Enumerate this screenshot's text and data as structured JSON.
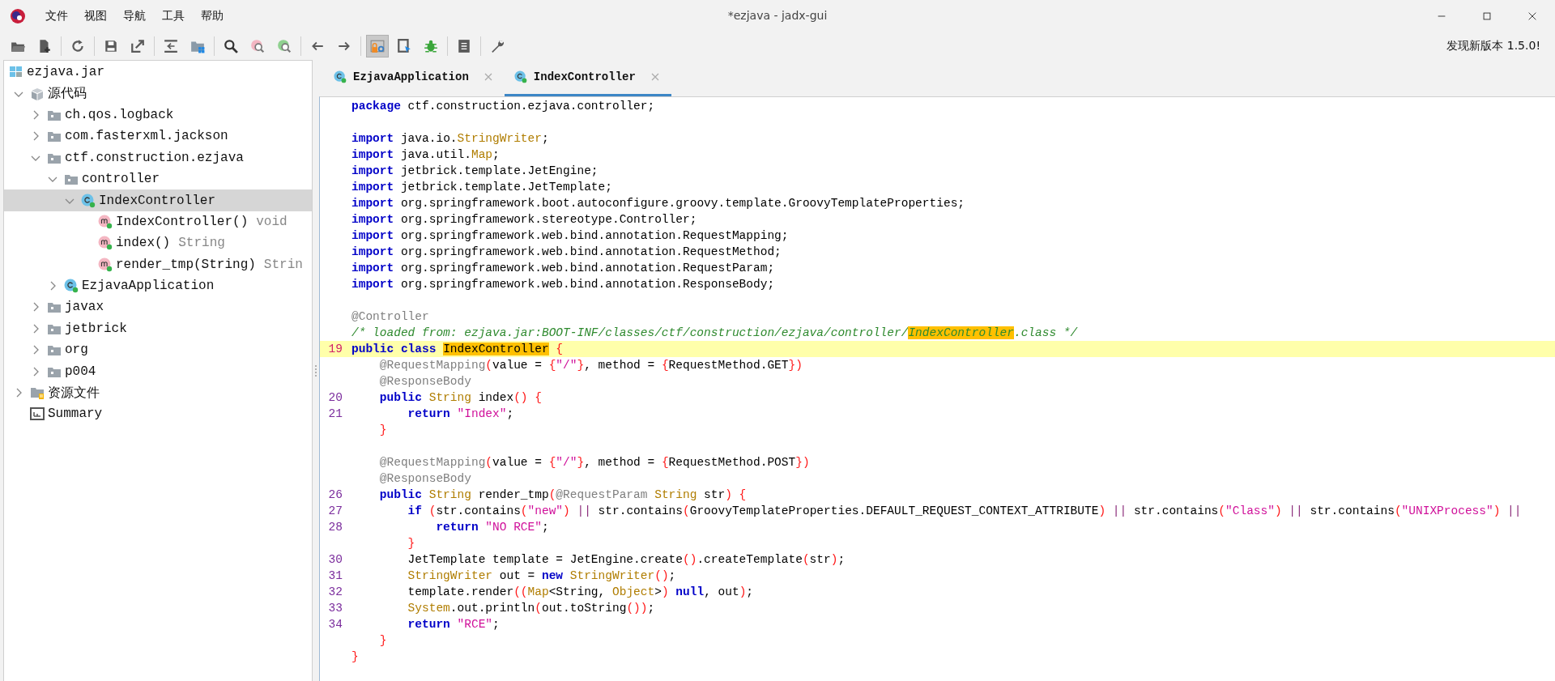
{
  "window": {
    "title": "*ezjava - jadx-gui"
  },
  "menu": [
    "文件",
    "视图",
    "导航",
    "工具",
    "帮助"
  ],
  "toolbar": [
    {
      "kind": "open",
      "pressed": false
    },
    {
      "kind": "add-file",
      "pressed": false
    },
    {
      "kind": "separator"
    },
    {
      "kind": "refresh",
      "pressed": false
    },
    {
      "kind": "separator"
    },
    {
      "kind": "save",
      "pressed": false
    },
    {
      "kind": "export",
      "pressed": false
    },
    {
      "kind": "separator"
    },
    {
      "kind": "sync",
      "pressed": false
    },
    {
      "kind": "grid-folder",
      "pressed": false
    },
    {
      "kind": "separator"
    },
    {
      "kind": "search",
      "pressed": false
    },
    {
      "kind": "search-pink",
      "pressed": false
    },
    {
      "kind": "search-green",
      "pressed": false
    },
    {
      "kind": "separator"
    },
    {
      "kind": "back",
      "pressed": false
    },
    {
      "kind": "forward",
      "pressed": false
    },
    {
      "kind": "separator"
    },
    {
      "kind": "lock-gear",
      "pressed": true
    },
    {
      "kind": "doc-cursor",
      "pressed": false
    },
    {
      "kind": "bug",
      "pressed": false
    },
    {
      "kind": "separator"
    },
    {
      "kind": "list",
      "pressed": false
    },
    {
      "kind": "separator"
    },
    {
      "kind": "wrench",
      "pressed": false
    }
  ],
  "update_notice": "发现新版本 1.5.0!",
  "tree": [
    {
      "kind": "jar",
      "label": "ezjava.jar",
      "selected": false,
      "children": [
        {
          "kind": "sources",
          "label": "源代码",
          "expanded": true,
          "selected": false,
          "children": [
            {
              "kind": "package",
              "label": "ch.qos.logback",
              "expanded": false,
              "selected": false
            },
            {
              "kind": "package",
              "label": "com.fasterxml.jackson",
              "expanded": false,
              "selected": false
            },
            {
              "kind": "package",
              "label": "ctf.construction.ezjava",
              "expanded": true,
              "selected": false,
              "children": [
                {
                  "kind": "package",
                  "label": "controller",
                  "expanded": true,
                  "selected": false,
                  "children": [
                    {
                      "kind": "class",
                      "label": "IndexController",
                      "expanded": true,
                      "selected": true,
                      "children": [
                        {
                          "kind": "method",
                          "label": "IndexController()",
                          "type": "void",
                          "selected": false
                        },
                        {
                          "kind": "method",
                          "label": "index()",
                          "type": "String",
                          "selected": false
                        },
                        {
                          "kind": "method",
                          "label": "render_tmp(String)",
                          "type": "Strin",
                          "selected": false
                        }
                      ]
                    }
                  ]
                },
                {
                  "kind": "class",
                  "label": "EzjavaApplication",
                  "expanded": false,
                  "selected": false
                }
              ]
            },
            {
              "kind": "package",
              "label": "javax",
              "expanded": false,
              "selected": false
            },
            {
              "kind": "package",
              "label": "jetbrick",
              "expanded": false,
              "selected": false
            },
            {
              "kind": "package",
              "label": "org",
              "expanded": false,
              "selected": false
            },
            {
              "kind": "package",
              "label": "p004",
              "expanded": false,
              "selected": false
            }
          ]
        },
        {
          "kind": "resources",
          "label": "资源文件",
          "expanded": false,
          "selected": false
        },
        {
          "kind": "summary",
          "label": "Summary",
          "selected": false
        }
      ]
    }
  ],
  "tabs": [
    {
      "label": "EzjavaApplication",
      "selected": false
    },
    {
      "label": "IndexController",
      "selected": true
    }
  ],
  "code": [
    {
      "kind": "code",
      "current": false,
      "segments": [
        {
          "kind": "keyword",
          "text": "package"
        },
        {
          "kind": "plain",
          "text": " ctf.construction.ezjava.controller;"
        }
      ]
    },
    {
      "kind": "blank"
    },
    {
      "kind": "code",
      "current": false,
      "segments": [
        {
          "kind": "keyword",
          "text": "import"
        },
        {
          "kind": "plain",
          "text": " java.io."
        },
        {
          "kind": "type",
          "text": "StringWriter"
        },
        {
          "kind": "plain",
          "text": ";"
        }
      ]
    },
    {
      "kind": "code",
      "current": false,
      "segments": [
        {
          "kind": "keyword",
          "text": "import"
        },
        {
          "kind": "plain",
          "text": " java.util."
        },
        {
          "kind": "type",
          "text": "Map"
        },
        {
          "kind": "plain",
          "text": ";"
        }
      ]
    },
    {
      "kind": "code",
      "current": false,
      "segments": [
        {
          "kind": "keyword",
          "text": "import"
        },
        {
          "kind": "plain",
          "text": " jetbrick.template.JetEngine;"
        }
      ]
    },
    {
      "kind": "code",
      "current": false,
      "segments": [
        {
          "kind": "keyword",
          "text": "import"
        },
        {
          "kind": "plain",
          "text": " jetbrick.template.JetTemplate;"
        }
      ]
    },
    {
      "kind": "code",
      "current": false,
      "segments": [
        {
          "kind": "keyword",
          "text": "import"
        },
        {
          "kind": "plain",
          "text": " org.springframework.boot.autoconfigure.groovy.template.GroovyTemplateProperties;"
        }
      ]
    },
    {
      "kind": "code",
      "current": false,
      "segments": [
        {
          "kind": "keyword",
          "text": "import"
        },
        {
          "kind": "plain",
          "text": " org.springframework.stereotype.Controller;"
        }
      ]
    },
    {
      "kind": "code",
      "current": false,
      "segments": [
        {
          "kind": "keyword",
          "text": "import"
        },
        {
          "kind": "plain",
          "text": " org.springframework.web.bind.annotation.RequestMapping;"
        }
      ]
    },
    {
      "kind": "code",
      "current": false,
      "segments": [
        {
          "kind": "keyword",
          "text": "import"
        },
        {
          "kind": "plain",
          "text": " org.springframework.web.bind.annotation.RequestMethod;"
        }
      ]
    },
    {
      "kind": "code",
      "current": false,
      "segments": [
        {
          "kind": "keyword",
          "text": "import"
        },
        {
          "kind": "plain",
          "text": " org.springframework.web.bind.annotation.RequestParam;"
        }
      ]
    },
    {
      "kind": "code",
      "current": false,
      "segments": [
        {
          "kind": "keyword",
          "text": "import"
        },
        {
          "kind": "plain",
          "text": " org.springframework.web.bind.annotation.ResponseBody;"
        }
      ]
    },
    {
      "kind": "blank"
    },
    {
      "kind": "code",
      "current": false,
      "segments": [
        {
          "kind": "annotation",
          "text": "@Controller"
        }
      ]
    },
    {
      "kind": "code",
      "current": false,
      "segments": [
        {
          "kind": "comment",
          "text": "/* loaded from: ezjava.jar:BOOT-INF/classes/ctf/construction/ezjava/controller/"
        },
        {
          "kind": "comment-mark",
          "text": "IndexController"
        },
        {
          "kind": "comment",
          "text": ".class */"
        }
      ]
    },
    {
      "kind": "code",
      "number": "19",
      "current": true,
      "segments": [
        {
          "kind": "keyword",
          "text": "public class "
        },
        {
          "kind": "mark",
          "text": "IndexController"
        },
        {
          "kind": "bracket",
          "text": " {"
        }
      ]
    },
    {
      "kind": "code",
      "current": false,
      "segments": [
        {
          "kind": "annotation",
          "text": "    @RequestMapping"
        },
        {
          "kind": "bracket",
          "text": "("
        },
        {
          "kind": "plain",
          "text": "value = "
        },
        {
          "kind": "bracket",
          "text": "{"
        },
        {
          "kind": "string",
          "text": "\"/\""
        },
        {
          "kind": "bracket",
          "text": "}"
        },
        {
          "kind": "plain",
          "text": ", method = "
        },
        {
          "kind": "bracket",
          "text": "{"
        },
        {
          "kind": "plain",
          "text": "RequestMethod.GET"
        },
        {
          "kind": "bracket",
          "text": "})"
        }
      ]
    },
    {
      "kind": "code",
      "current": false,
      "segments": [
        {
          "kind": "annotation",
          "text": "    @ResponseBody"
        }
      ]
    },
    {
      "kind": "code",
      "number": "20",
      "current": false,
      "segments": [
        {
          "kind": "keyword",
          "text": "    public "
        },
        {
          "kind": "type",
          "text": "String"
        },
        {
          "kind": "plain",
          "text": " index"
        },
        {
          "kind": "bracket",
          "text": "() {"
        }
      ]
    },
    {
      "kind": "code",
      "number": "21",
      "current": false,
      "segments": [
        {
          "kind": "keyword",
          "text": "        return "
        },
        {
          "kind": "string",
          "text": "\"Index\""
        },
        {
          "kind": "plain",
          "text": ";"
        }
      ]
    },
    {
      "kind": "code",
      "current": false,
      "segments": [
        {
          "kind": "bracket",
          "text": "    }"
        }
      ]
    },
    {
      "kind": "blank"
    },
    {
      "kind": "code",
      "current": false,
      "segments": [
        {
          "kind": "annotation",
          "text": "    @RequestMapping"
        },
        {
          "kind": "bracket",
          "text": "("
        },
        {
          "kind": "plain",
          "text": "value = "
        },
        {
          "kind": "bracket",
          "text": "{"
        },
        {
          "kind": "string",
          "text": "\"/\""
        },
        {
          "kind": "bracket",
          "text": "}"
        },
        {
          "kind": "plain",
          "text": ", method = "
        },
        {
          "kind": "bracket",
          "text": "{"
        },
        {
          "kind": "plain",
          "text": "RequestMethod.POST"
        },
        {
          "kind": "bracket",
          "text": "})"
        }
      ]
    },
    {
      "kind": "code",
      "current": false,
      "segments": [
        {
          "kind": "annotation",
          "text": "    @ResponseBody"
        }
      ]
    },
    {
      "kind": "code",
      "number": "26",
      "current": false,
      "segments": [
        {
          "kind": "keyword",
          "text": "    public "
        },
        {
          "kind": "type",
          "text": "String"
        },
        {
          "kind": "plain",
          "text": " render_tmp"
        },
        {
          "kind": "bracket",
          "text": "("
        },
        {
          "kind": "annotation",
          "text": "@RequestParam "
        },
        {
          "kind": "type",
          "text": "String"
        },
        {
          "kind": "plain",
          "text": " str"
        },
        {
          "kind": "bracket",
          "text": ") {"
        }
      ]
    },
    {
      "kind": "code",
      "number": "27",
      "current": false,
      "segments": [
        {
          "kind": "keyword",
          "text": "        if "
        },
        {
          "kind": "bracket",
          "text": "("
        },
        {
          "kind": "plain",
          "text": "str.contains"
        },
        {
          "kind": "bracket",
          "text": "("
        },
        {
          "kind": "string",
          "text": "\"new\""
        },
        {
          "kind": "bracket",
          "text": ")"
        },
        {
          "kind": "operator",
          "text": " ||"
        },
        {
          "kind": "plain",
          "text": " str.contains"
        },
        {
          "kind": "bracket",
          "text": "("
        },
        {
          "kind": "plain",
          "text": "GroovyTemplateProperties.DEFAULT_REQUEST_CONTEXT_ATTRIBUTE"
        },
        {
          "kind": "bracket",
          "text": ")"
        },
        {
          "kind": "operator",
          "text": " ||"
        },
        {
          "kind": "plain",
          "text": " str.contains"
        },
        {
          "kind": "bracket",
          "text": "("
        },
        {
          "kind": "string",
          "text": "\"Class\""
        },
        {
          "kind": "bracket",
          "text": ")"
        },
        {
          "kind": "operator",
          "text": " ||"
        },
        {
          "kind": "plain",
          "text": " str.contains"
        },
        {
          "kind": "bracket",
          "text": "("
        },
        {
          "kind": "string",
          "text": "\"UNIXProcess\""
        },
        {
          "kind": "bracket",
          "text": ")"
        },
        {
          "kind": "operator",
          "text": " ||"
        }
      ]
    },
    {
      "kind": "code",
      "number": "28",
      "current": false,
      "segments": [
        {
          "kind": "keyword",
          "text": "            return "
        },
        {
          "kind": "string",
          "text": "\"NO RCE\""
        },
        {
          "kind": "plain",
          "text": ";"
        }
      ]
    },
    {
      "kind": "code",
      "current": false,
      "segments": [
        {
          "kind": "bracket",
          "text": "        }"
        }
      ]
    },
    {
      "kind": "code",
      "number": "30",
      "current": false,
      "segments": [
        {
          "kind": "plain",
          "text": "        JetTemplate template = JetEngine.create"
        },
        {
          "kind": "bracket",
          "text": "()"
        },
        {
          "kind": "plain",
          "text": ".createTemplate"
        },
        {
          "kind": "bracket",
          "text": "("
        },
        {
          "kind": "plain",
          "text": "str"
        },
        {
          "kind": "bracket",
          "text": ")"
        },
        {
          "kind": "plain",
          "text": ";"
        }
      ]
    },
    {
      "kind": "code",
      "number": "31",
      "current": false,
      "segments": [
        {
          "kind": "type",
          "text": "        StringWriter"
        },
        {
          "kind": "plain",
          "text": " out = "
        },
        {
          "kind": "keyword",
          "text": "new "
        },
        {
          "kind": "type",
          "text": "StringWriter"
        },
        {
          "kind": "bracket",
          "text": "()"
        },
        {
          "kind": "plain",
          "text": ";"
        }
      ]
    },
    {
      "kind": "code",
      "number": "32",
      "current": false,
      "segments": [
        {
          "kind": "plain",
          "text": "        template.render"
        },
        {
          "kind": "bracket",
          "text": "(("
        },
        {
          "kind": "type",
          "text": "Map"
        },
        {
          "kind": "plain",
          "text": "<String, "
        },
        {
          "kind": "type",
          "text": "Object"
        },
        {
          "kind": "plain",
          "text": ">"
        },
        {
          "kind": "bracket",
          "text": ")"
        },
        {
          "kind": "keyword",
          "text": " null"
        },
        {
          "kind": "plain",
          "text": ", out"
        },
        {
          "kind": "bracket",
          "text": ")"
        },
        {
          "kind": "plain",
          "text": ";"
        }
      ]
    },
    {
      "kind": "code",
      "number": "33",
      "current": false,
      "segments": [
        {
          "kind": "type",
          "text": "        System"
        },
        {
          "kind": "plain",
          "text": ".out.println"
        },
        {
          "kind": "bracket",
          "text": "("
        },
        {
          "kind": "plain",
          "text": "out.toString"
        },
        {
          "kind": "bracket",
          "text": "())"
        },
        {
          "kind": "plain",
          "text": ";"
        }
      ]
    },
    {
      "kind": "code",
      "number": "34",
      "current": false,
      "segments": [
        {
          "kind": "keyword",
          "text": "        return "
        },
        {
          "kind": "string",
          "text": "\"RCE\""
        },
        {
          "kind": "plain",
          "text": ";"
        }
      ]
    },
    {
      "kind": "code",
      "current": false,
      "segments": [
        {
          "kind": "bracket",
          "text": "    }"
        }
      ]
    },
    {
      "kind": "code",
      "current": false,
      "segments": [
        {
          "kind": "bracket",
          "text": "}"
        }
      ]
    }
  ]
}
